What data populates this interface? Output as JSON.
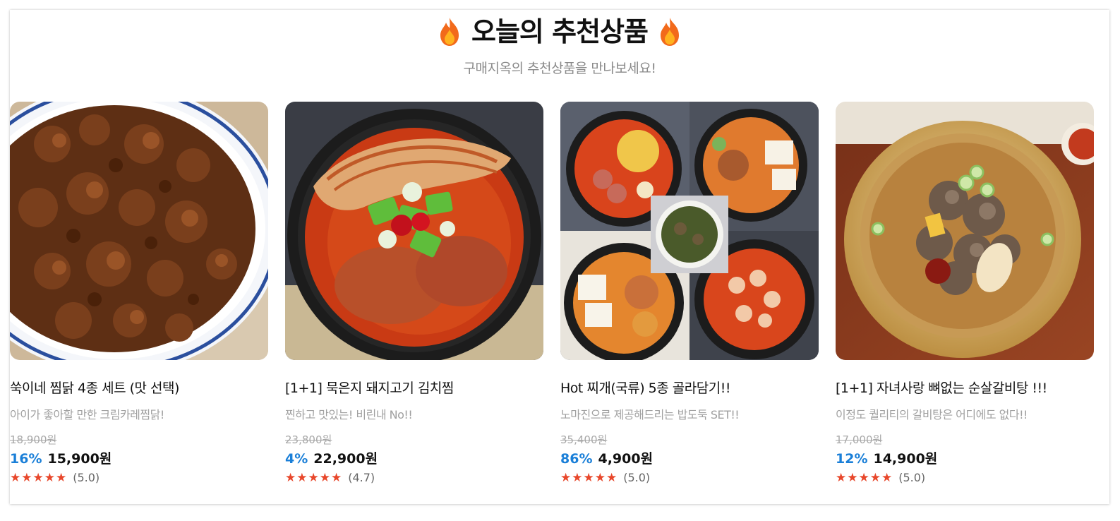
{
  "section": {
    "title": "오늘의 추천상품",
    "subtitle": "구매지옥의 추천상품을 만나보세요!",
    "title_icon": "fire-icon",
    "accent_color": "#1a7fd8",
    "star_color": "#e8472b"
  },
  "products": [
    {
      "name": "쑥이네 찜닭 4종 세트 (맛 선택)",
      "description": "아이가 좋아할 만한 크림카레찜닭!",
      "original_price": "18,900원",
      "discount": "16%",
      "price": "15,900원",
      "stars": "★★★★★",
      "rating": "(5.0)",
      "image": "braised-chicken-photo"
    },
    {
      "name": "[1+1] 묵은지 돼지고기 김치찜",
      "description": "찐하고 맛있는! 비린내 No!!",
      "original_price": "23,800원",
      "discount": "4%",
      "price": "22,900원",
      "stars": "★★★★★",
      "rating": "(4.7)",
      "image": "kimchi-stew-photo"
    },
    {
      "name": "Hot 찌개(국류) 5종 골라담기!!",
      "description": "노마진으로 제공해드리는 밥도둑 SET!!",
      "original_price": "35,400원",
      "discount": "86%",
      "price": "4,900원",
      "stars": "★★★★★",
      "rating": "(5.0)",
      "image": "stew-collage-photo"
    },
    {
      "name": "[1+1] 자녀사랑 뼈없는 순살갈비탕 !!!",
      "description": "이정도 퀄리티의 갈비탕은 어디에도 없다!!",
      "original_price": "17,000원",
      "discount": "12%",
      "price": "14,900원",
      "stars": "★★★★★",
      "rating": "(5.0)",
      "image": "galbitang-photo"
    }
  ]
}
